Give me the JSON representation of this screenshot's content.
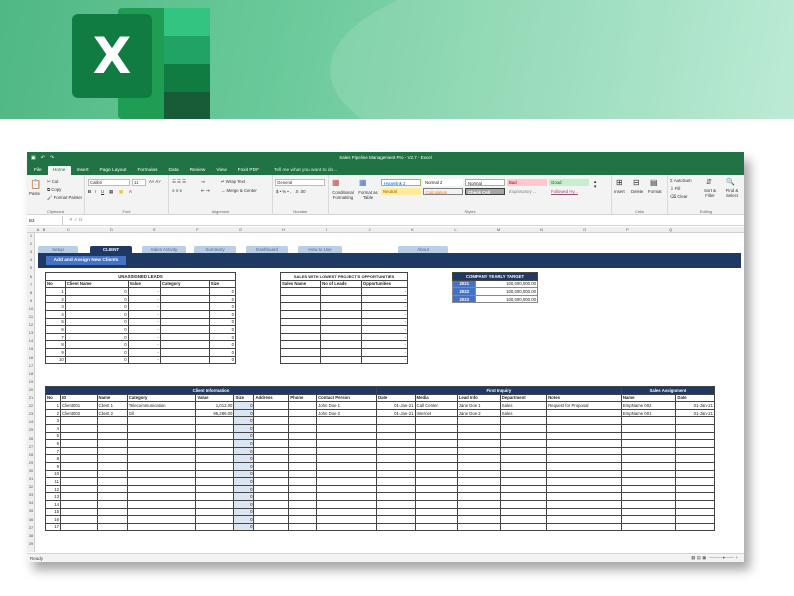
{
  "banner": {
    "logo_letter": "X"
  },
  "excel": {
    "title": "Sales Pipeline Management Pro - V2.7 - Excel",
    "tabs": [
      "File",
      "Home",
      "Insert",
      "Page Layout",
      "Formulas",
      "Data",
      "Review",
      "View",
      "Foxit PDF"
    ],
    "tell_me": "Tell me what you want to do...",
    "ribbon": {
      "clipboard": {
        "paste": "Paste",
        "cut": "Cut",
        "copy": "Copy",
        "format_painter": "Format Painter",
        "label": "Clipboard"
      },
      "font": {
        "name": "Calibri",
        "size": "11",
        "label": "Font"
      },
      "alignment": {
        "wrap": "Wrap Text",
        "merge": "Merge & Center",
        "label": "Alignment"
      },
      "number": {
        "format": "General",
        "label": "Number"
      },
      "styles": {
        "cond": "Conditional Formatting",
        "table": "Format as Table",
        "cells": [
          "Hyperlink 2",
          "Normal 2",
          "Normal",
          "Bad",
          "Good",
          "Neutral",
          "Calculation",
          "Check Cell",
          "Explanatory ...",
          "Followed Hy..."
        ],
        "label": "Styles"
      },
      "cells": {
        "insert": "Insert",
        "delete": "Delete",
        "format": "Format",
        "label": "Cells"
      },
      "editing": {
        "autosum": "AutoSum",
        "fill": "Fill",
        "clear": "Clear",
        "sort": "Sort & Filter",
        "find": "Find & Select",
        "label": "Editing"
      }
    },
    "name_box": "B3",
    "columns": [
      "A",
      "B",
      "C",
      "D",
      "E",
      "F",
      "G",
      "H",
      "I",
      "J",
      "K",
      "L",
      "M",
      "N",
      "O",
      "P",
      "Q"
    ],
    "rows": [
      "1",
      "2",
      "3",
      "4",
      "5",
      "6",
      "7",
      "8",
      "9",
      "10",
      "11",
      "12",
      "13",
      "14",
      "15",
      "16",
      "17",
      "18",
      "19",
      "20",
      "21",
      "22",
      "23",
      "24",
      "25",
      "26",
      "27",
      "28",
      "29",
      "30",
      "31",
      "32",
      "33",
      "34",
      "35",
      "36",
      "37",
      "38",
      "39"
    ],
    "nav_tabs": [
      "Setup",
      "CLIENT",
      "Sales Activity",
      "Summary",
      "Dashboard",
      "How to Use",
      "About"
    ],
    "add_button": "Add and Assign New Clients",
    "unassigned": {
      "title": "UNASSIGNED LEADS",
      "headers": [
        "No",
        "Client Name",
        "Value",
        "Category",
        "Size"
      ],
      "rows": [
        [
          "1",
          "0",
          "-",
          "",
          "0"
        ],
        [
          "2",
          "0",
          "-",
          "",
          "0"
        ],
        [
          "3",
          "0",
          "-",
          "",
          "0"
        ],
        [
          "4",
          "0",
          "-",
          "",
          "0"
        ],
        [
          "5",
          "0",
          "-",
          "",
          "0"
        ],
        [
          "6",
          "0",
          "-",
          "",
          "0"
        ],
        [
          "7",
          "0",
          "-",
          "",
          "0"
        ],
        [
          "8",
          "0",
          "-",
          "",
          "0"
        ],
        [
          "9",
          "0",
          "-",
          "",
          "0"
        ],
        [
          "10",
          "0",
          "-",
          "",
          "0"
        ]
      ]
    },
    "lowest": {
      "title": "SALES WITH LOWEST PROJECT'S OPPORTUNITIES",
      "headers": [
        "Sales Name",
        "No of Leads",
        "Opportunities"
      ],
      "rows": [
        "-",
        "-",
        "-",
        "-",
        "-",
        "-",
        "-",
        "-",
        "-",
        "-"
      ]
    },
    "target": {
      "title": "COMPANY YEARLY TARGET",
      "rows": [
        [
          "2021",
          "100,000,000.00"
        ],
        [
          "2022",
          "100,000,000.00"
        ],
        [
          "2023",
          "100,000,000.00"
        ]
      ]
    },
    "client_table": {
      "group_client": "Client Information",
      "group_inquiry": "First Inquiry",
      "group_assign": "Sales Assignment",
      "headers": [
        "No",
        "ID",
        "Name",
        "Category",
        "Value",
        "Size",
        "Address",
        "Phone",
        "Contact Person",
        "Date",
        "Media",
        "Lead Info",
        "Department",
        "Notes",
        "Name",
        "Date"
      ],
      "rows": [
        [
          "1",
          "Client001",
          "Client 1",
          "Telecommunication",
          "1,012.00",
          "0",
          "",
          "",
          "John Doe 1",
          "01-Jan-21",
          "Call Center",
          "Jane Doe 1",
          "Sales",
          "Request for Proposal",
          "EmpName 002",
          "01-Jan-21"
        ],
        [
          "2",
          "Client002",
          "Client 2",
          "Oil",
          "95,286.00",
          "0",
          "",
          "",
          "John Doe 2",
          "01-Jan-21",
          "Internet",
          "Jane Doe 2",
          "Sales",
          "",
          "EmpName 001",
          "01-Jan-21"
        ],
        [
          "3",
          "",
          "",
          "",
          "",
          "0",
          "",
          "",
          "",
          "",
          "",
          "",
          "",
          "",
          "",
          ""
        ],
        [
          "4",
          "",
          "",
          "",
          "",
          "0",
          "",
          "",
          "",
          "",
          "",
          "",
          "",
          "",
          "",
          ""
        ],
        [
          "5",
          "",
          "",
          "",
          "",
          "0",
          "",
          "",
          "",
          "",
          "",
          "",
          "",
          "",
          "",
          ""
        ],
        [
          "6",
          "",
          "",
          "",
          "",
          "0",
          "",
          "",
          "",
          "",
          "",
          "",
          "",
          "",
          "",
          ""
        ],
        [
          "7",
          "",
          "",
          "",
          "",
          "0",
          "",
          "",
          "",
          "",
          "",
          "",
          "",
          "",
          "",
          ""
        ],
        [
          "8",
          "",
          "",
          "",
          "",
          "0",
          "",
          "",
          "",
          "",
          "",
          "",
          "",
          "",
          "",
          ""
        ],
        [
          "9",
          "",
          "",
          "",
          "",
          "0",
          "",
          "",
          "",
          "",
          "",
          "",
          "",
          "",
          "",
          ""
        ],
        [
          "10",
          "",
          "",
          "",
          "",
          "0",
          "",
          "",
          "",
          "",
          "",
          "",
          "",
          "",
          "",
          ""
        ],
        [
          "11",
          "",
          "",
          "",
          "",
          "0",
          "",
          "",
          "",
          "",
          "",
          "",
          "",
          "",
          "",
          ""
        ],
        [
          "12",
          "",
          "",
          "",
          "",
          "0",
          "",
          "",
          "",
          "",
          "",
          "",
          "",
          "",
          "",
          ""
        ],
        [
          "13",
          "",
          "",
          "",
          "",
          "0",
          "",
          "",
          "",
          "",
          "",
          "",
          "",
          "",
          "",
          ""
        ],
        [
          "14",
          "",
          "",
          "",
          "",
          "0",
          "",
          "",
          "",
          "",
          "",
          "",
          "",
          "",
          "",
          ""
        ],
        [
          "15",
          "",
          "",
          "",
          "",
          "0",
          "",
          "",
          "",
          "",
          "",
          "",
          "",
          "",
          "",
          ""
        ],
        [
          "16",
          "",
          "",
          "",
          "",
          "0",
          "",
          "",
          "",
          "",
          "",
          "",
          "",
          "",
          "",
          ""
        ],
        [
          "17",
          "",
          "",
          "",
          "",
          "0",
          "",
          "",
          "",
          "",
          "",
          "",
          "",
          "",
          "",
          ""
        ]
      ]
    },
    "status": "Ready"
  }
}
